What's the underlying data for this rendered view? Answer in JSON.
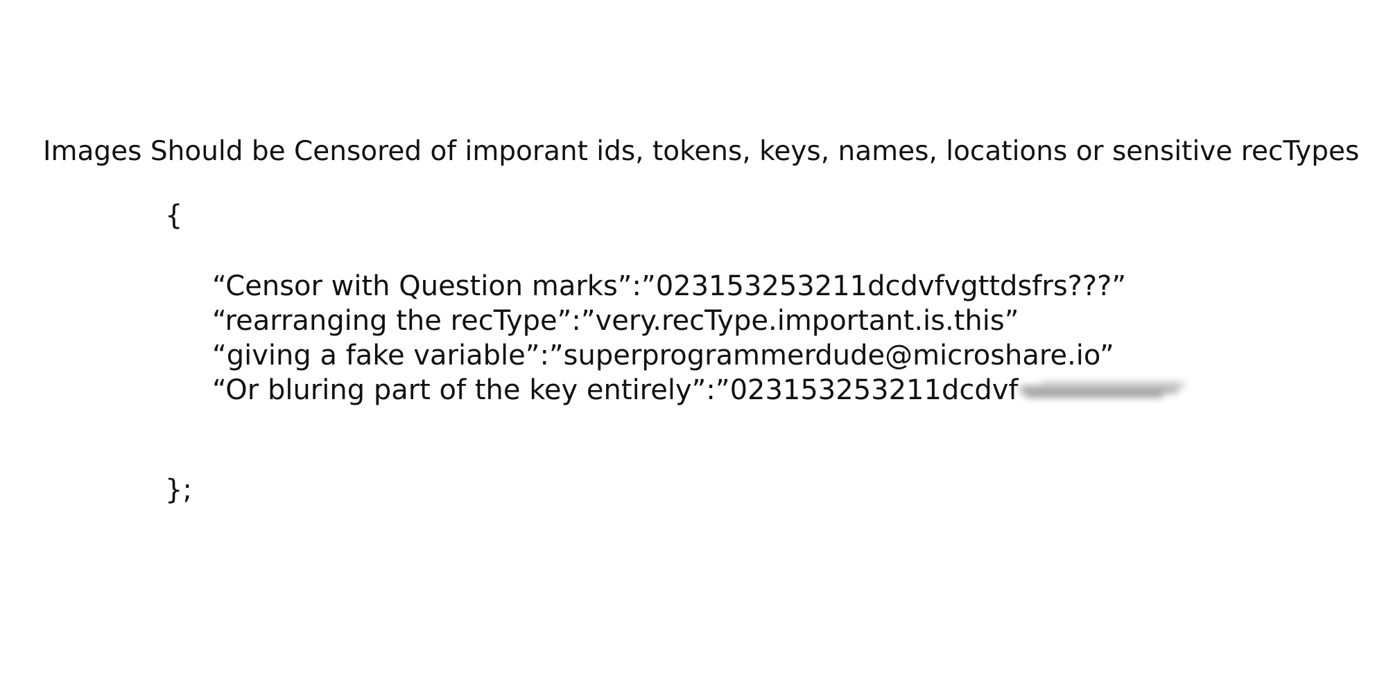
{
  "heading": "Images Should be Censored of imporant ids, tokens, keys, names, locations or sensitive recTypes",
  "code": {
    "open_brace": "{",
    "close_brace": "};",
    "lines": [
      "“Censor with Question marks”:”023153253211dcdvfvgttdsfrs???”",
      "“rearranging the recType”:”very.recType.important.is.this”",
      "“giving a fake variable”:”superprogrammerdude@microshare.io”",
      "“Or bluring part of the key entirely”:”023153253211dcdvf"
    ]
  }
}
